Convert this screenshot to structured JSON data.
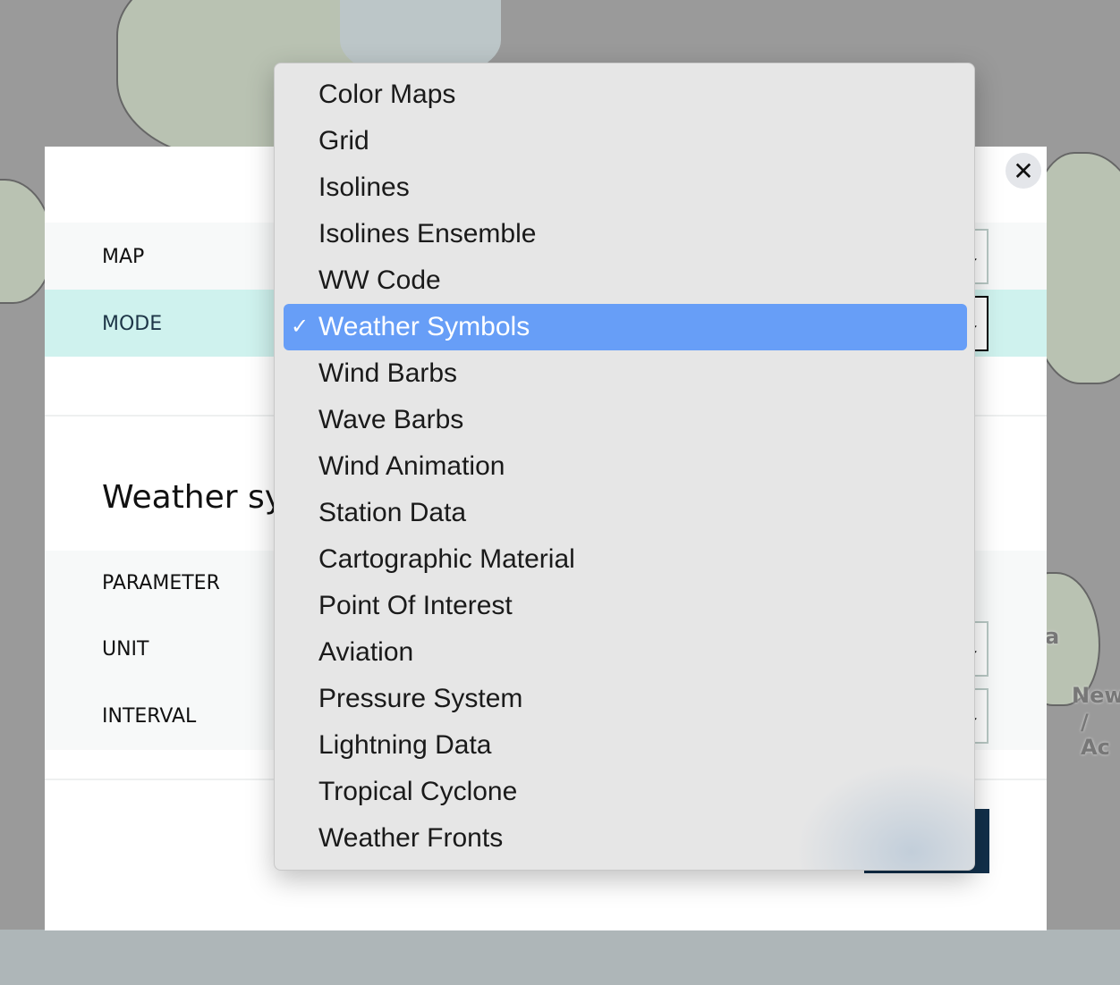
{
  "map": {
    "labels": [
      "a",
      "New",
      "/ Ac"
    ]
  },
  "modal": {
    "close_icon": "close-icon",
    "rows": [
      {
        "label": "MAP"
      },
      {
        "label": "MODE"
      }
    ],
    "section_heading": "Weather sy",
    "params": [
      {
        "label": "PARAMETER"
      },
      {
        "label": "UNIT"
      },
      {
        "label": "INTERVAL"
      }
    ]
  },
  "dropdown": {
    "selected": "Weather Symbols",
    "check": "✓",
    "options": [
      "Color Maps",
      "Grid",
      "Isolines",
      "Isolines Ensemble",
      "WW Code",
      "Weather Symbols",
      "Wind Barbs",
      "Wave Barbs",
      "Wind Animation",
      "Station Data",
      "Cartographic Material",
      "Point Of Interest",
      "Aviation",
      "Pressure System",
      "Lightning Data",
      "Tropical Cyclone",
      "Weather Fronts"
    ]
  },
  "colors": {
    "highlight": "#679ef7",
    "mode_row": "#cff2ee",
    "button": "#12304b"
  }
}
